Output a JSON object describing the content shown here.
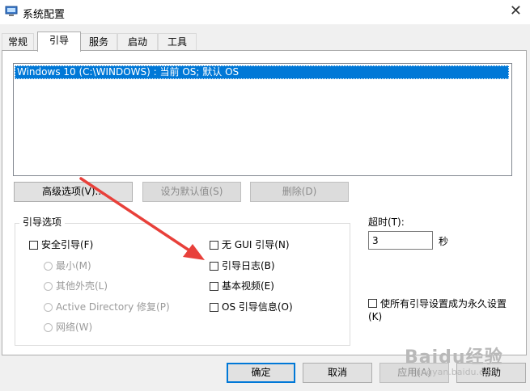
{
  "window": {
    "title": "系统配置"
  },
  "tabs": [
    {
      "label": "常规",
      "active": false
    },
    {
      "label": "引导",
      "active": true
    },
    {
      "label": "服务",
      "active": false
    },
    {
      "label": "启动",
      "active": false
    },
    {
      "label": "工具",
      "active": false
    }
  ],
  "os_list": {
    "items": [
      "Windows 10 (C:\\WINDOWS) : 当前 OS; 默认 OS"
    ]
  },
  "buttons": {
    "advanced": "高级选项(V)...",
    "set_default": "设为默认值(S)",
    "delete": "删除(D)"
  },
  "boot_options": {
    "legend": "引导选项",
    "safe_boot": "安全引导(F)",
    "minimal": "最小(M)",
    "alternate_shell": "其他外壳(L)",
    "active_directory": "Active Directory 修复(P)",
    "network": "网络(W)",
    "no_gui": "无 GUI 引导(N)",
    "boot_log": "引导日志(B)",
    "base_video": "基本视频(E)",
    "os_boot_info": "OS 引导信息(O)"
  },
  "timeout": {
    "label": "超时(T):",
    "value": "3",
    "unit": "秒"
  },
  "permanent": {
    "label": "使所有引导设置成为永久设置(K)"
  },
  "footer": {
    "ok": "确定",
    "cancel": "取消",
    "apply": "应用(A)",
    "help": "帮助"
  },
  "watermark": {
    "brand": "Baidu经验",
    "url": "jingyan.baidu.com"
  },
  "colors": {
    "selection": "#0078d7",
    "annotation_arrow": "#e8403a"
  }
}
